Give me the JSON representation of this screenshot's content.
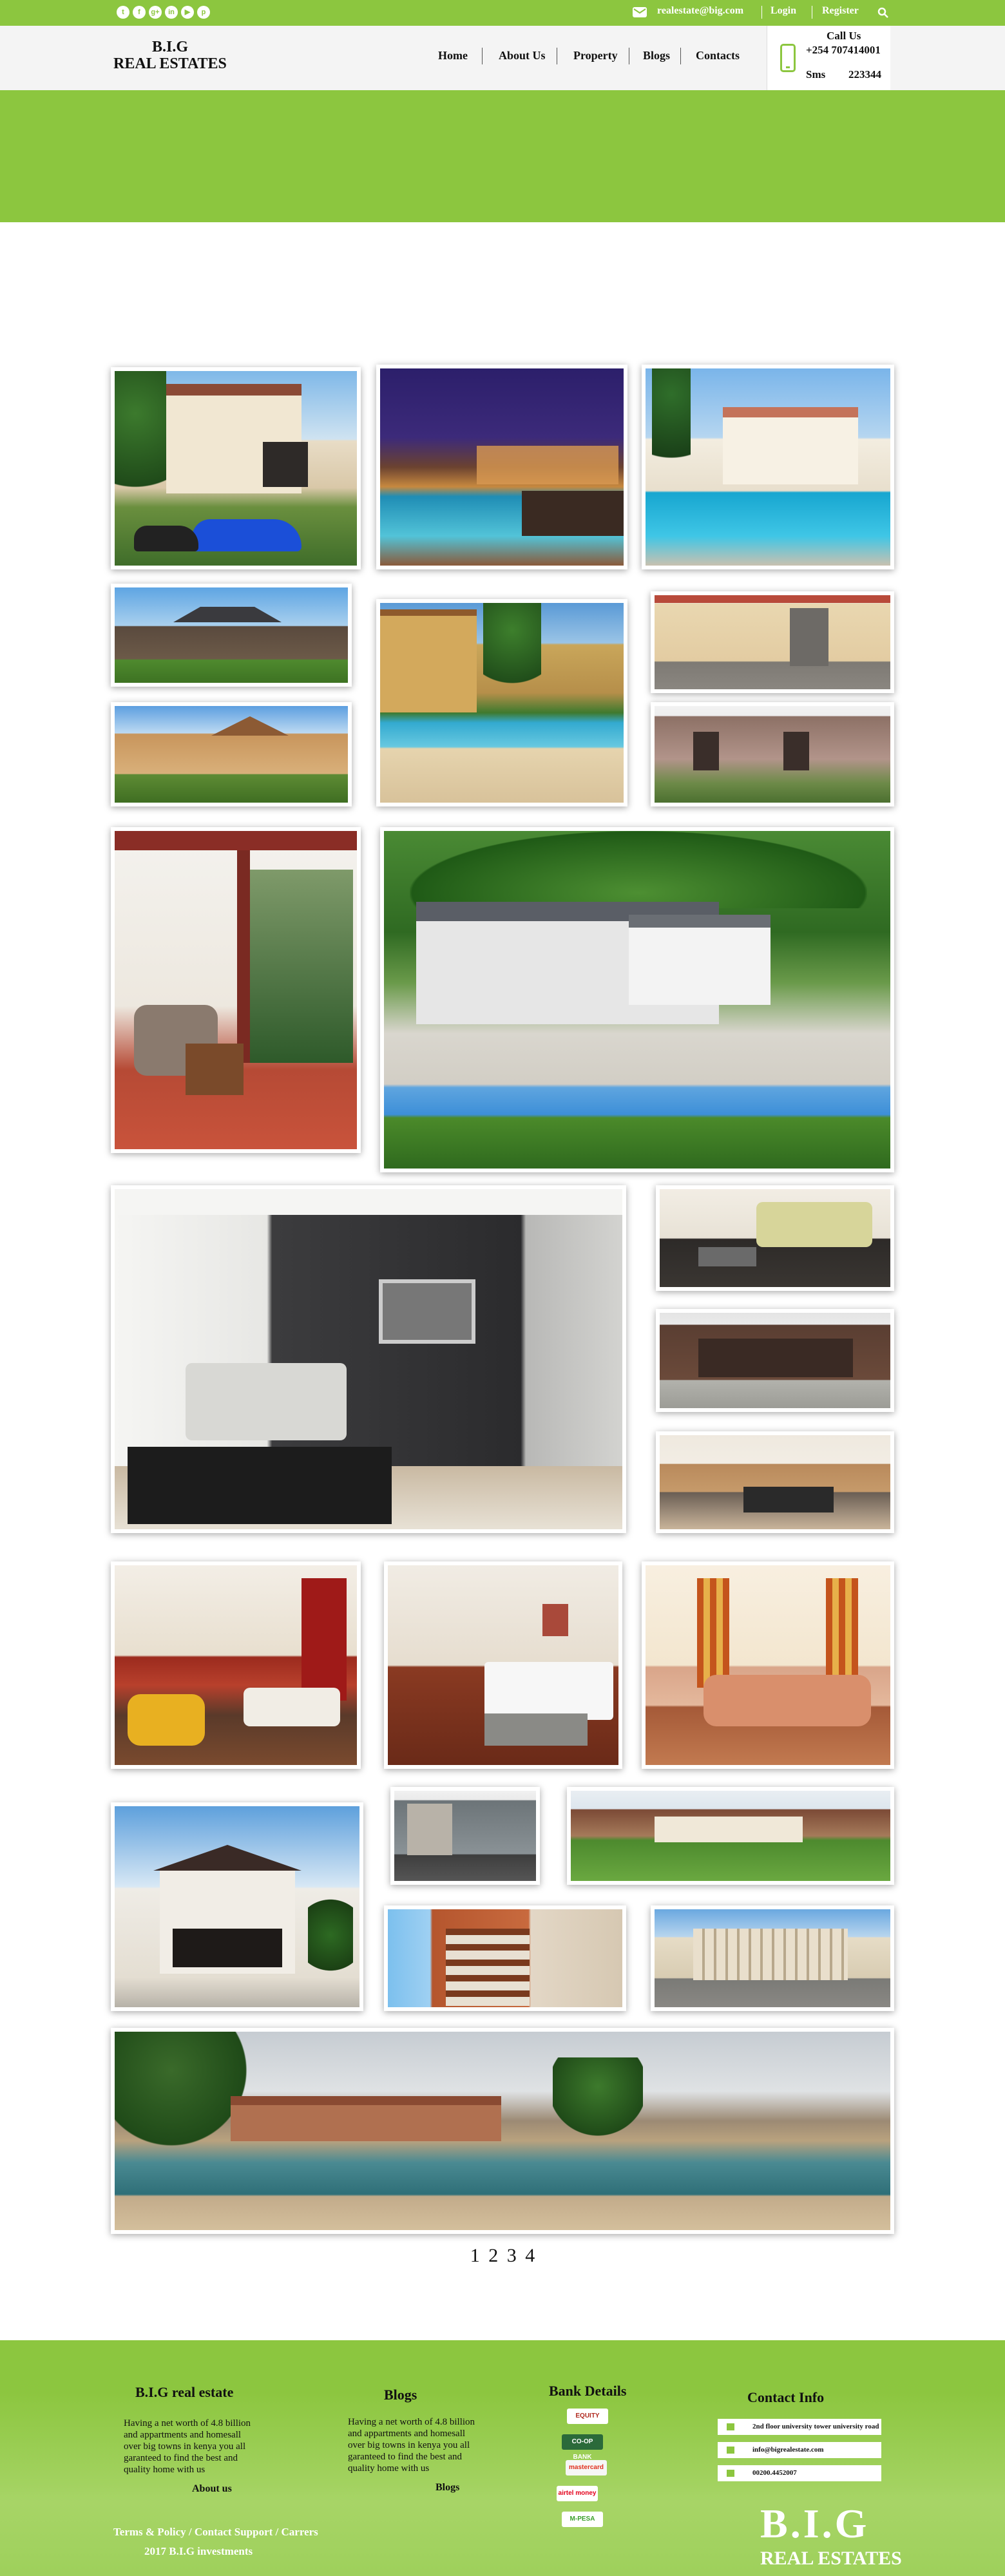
{
  "topbar": {
    "social_icons": [
      "twitter-icon",
      "facebook-icon",
      "google-plus-icon",
      "linkedin-icon",
      "youtube-icon",
      "pinterest-icon"
    ],
    "social_glyphs": [
      "t",
      "f",
      "g+",
      "in",
      "▶",
      "p"
    ],
    "email": "realestate@big.com",
    "login": "Login",
    "register": "Register"
  },
  "header": {
    "logo_top": "B.I.G",
    "logo_bottom": "REAL ESTATES",
    "nav": [
      "Home",
      "About Us",
      "Property",
      "Blogs",
      "Contacts"
    ],
    "call_us": "Call Us",
    "phone": "+254 707414001",
    "sms_label": "Sms",
    "sms_number": "223344"
  },
  "gallery": {
    "photos": [
      "villa-with-blue-sports-car",
      "night-pool-terrace",
      "villa-with-pool",
      "stone-house-lawn",
      "resort-pool-palms",
      "bungalow-stone-wall",
      "cottage-stone-facade",
      "modern-townhouse",
      "veranda-sofa",
      "mansion-with-pool",
      "living-room-tv-wall",
      "lounge-green-sofa",
      "modern-house-facade",
      "kitchen-interior",
      "living-room-red-curtains",
      "bedroom",
      "living-room-orange-sofa",
      "townhouse-row",
      "villa-manicured-garden",
      "colonial-house",
      "apartment-balconies",
      "apartment-complex",
      "resort-pool-panorama"
    ]
  },
  "pagination": [
    "1",
    "2",
    "3",
    "4"
  ],
  "footer": {
    "col1_title": "B.I.G real estate",
    "col1_lines": [
      "Having a net worth of 4.8 billion",
      "and appartments and homesall",
      "over big towns in kenya you all",
      "garanteed to find the best and",
      "quality home with us"
    ],
    "col1_link": "About us",
    "col2_title": "Blogs",
    "col2_lines": [
      "Having a net worth of 4.8 billion",
      "and appartments and homesall",
      "over big towns in kenya you all",
      "garanteed to find the best and",
      "quality home with us"
    ],
    "col2_link": "Blogs",
    "col3_title": "Bank Details",
    "banks": [
      "EQUITY",
      "CO-OP BANK",
      "mastercard",
      "airtel money",
      "M-PESA"
    ],
    "col4_title": "Contact Info",
    "contact_address": "2nd floor university tower university road",
    "contact_email": "info@bigrealestate.com",
    "contact_phone": "00200.4452007",
    "bottom_links": "Terms & Policy / Contact Support / Carrers",
    "copyright": "2017 B.I.G investments",
    "logo_big": "B.I.G",
    "logo_sub": "REAL ESTATES"
  },
  "colors": {
    "brand_green": "#8cc63f",
    "header_bg": "#f4f4f4"
  }
}
